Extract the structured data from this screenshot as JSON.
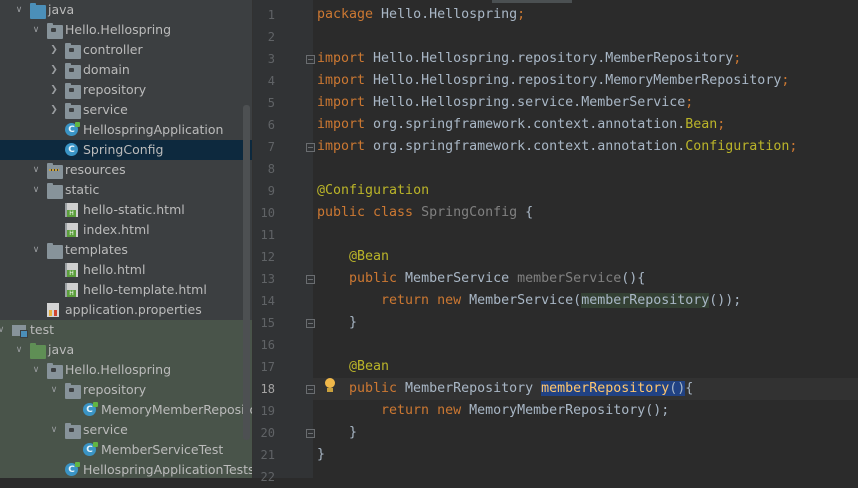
{
  "project_tree": {
    "items": [
      {
        "label": "java",
        "icon": "source-folder-icon",
        "expanded": true
      },
      {
        "label": "Hello.Hellospring",
        "icon": "package-icon",
        "expanded": true
      },
      {
        "label": "controller",
        "icon": "package-icon",
        "expanded": false
      },
      {
        "label": "domain",
        "icon": "package-icon",
        "expanded": false
      },
      {
        "label": "repository",
        "icon": "package-icon",
        "expanded": false
      },
      {
        "label": "service",
        "icon": "package-icon",
        "expanded": false
      },
      {
        "label": "HellospringApplication",
        "icon": "spring-class-icon"
      },
      {
        "label": "SpringConfig",
        "icon": "class-icon",
        "selected": true
      },
      {
        "label": "resources",
        "icon": "resources-folder-icon",
        "expanded": true
      },
      {
        "label": "static",
        "icon": "folder-icon",
        "expanded": true
      },
      {
        "label": "hello-static.html",
        "icon": "html-file-icon"
      },
      {
        "label": "index.html",
        "icon": "html-file-icon"
      },
      {
        "label": "templates",
        "icon": "folder-icon",
        "expanded": true
      },
      {
        "label": "hello.html",
        "icon": "html-file-icon"
      },
      {
        "label": "hello-template.html",
        "icon": "html-file-icon"
      },
      {
        "label": "application.properties",
        "icon": "properties-file-icon"
      },
      {
        "label": "test",
        "icon": "module-folder-icon",
        "expanded": true
      },
      {
        "label": "java",
        "icon": "test-source-folder-icon",
        "expanded": true
      },
      {
        "label": "Hello.Hellospring",
        "icon": "package-icon",
        "expanded": true
      },
      {
        "label": "repository",
        "icon": "package-icon",
        "expanded": true
      },
      {
        "label": "MemoryMemberRepositoryTest",
        "icon": "test-class-icon"
      },
      {
        "label": "service",
        "icon": "package-icon",
        "expanded": true
      },
      {
        "label": "MemberServiceTest",
        "icon": "test-class-icon"
      },
      {
        "label": "HellospringApplicationTests",
        "icon": "test-class-icon"
      }
    ]
  },
  "editor": {
    "current_line": 18,
    "line_numbers": [
      "1",
      "2",
      "3",
      "4",
      "5",
      "6",
      "7",
      "8",
      "9",
      "10",
      "11",
      "12",
      "13",
      "14",
      "15",
      "16",
      "17",
      "18",
      "19",
      "20",
      "21",
      "22"
    ],
    "code": {
      "l1_kw": "package",
      "l1_rest": " Hello.Hellospring",
      "semi": ";",
      "import_kw": "import",
      "l3_rest": " Hello.Hellospring.repository.MemberRepository",
      "l4_rest": " Hello.Hellospring.repository.MemoryMemberRepository",
      "l5_rest": " Hello.Hellospring.service.MemberService",
      "l6_rest": " org.springframework.context.annotation.",
      "l6_ann": "Bean",
      "l7_rest": " org.springframework.context.annotation.",
      "l7_ann": "Configuration",
      "l9_ann": "@Configuration",
      "l10_kw": "public class",
      "l10_name": " SpringConfig",
      "l10_brace": " {",
      "bean_ann": "@Bean",
      "public_kw": "public",
      "l13_type": " MemberService ",
      "l13_method": "memberService",
      "l13_tail": "(){",
      "return_kw": "return",
      "new_kw": "new",
      "l14_type": " MemberService(",
      "l14_ref": "memberRepository",
      "l14_tail": "());",
      "close_brace": "}",
      "l18_type": " MemberRepository ",
      "l18_method": "memberRepository",
      "l18_paren": "()",
      "l18_tail": "{",
      "l19_type": " MemoryMemberRepository();"
    }
  },
  "colors": {
    "keyword": "#cc7832",
    "annotation": "#bbb529",
    "text": "#a9b7c6",
    "selection": "#214283",
    "tree_selection": "#0d293e"
  }
}
